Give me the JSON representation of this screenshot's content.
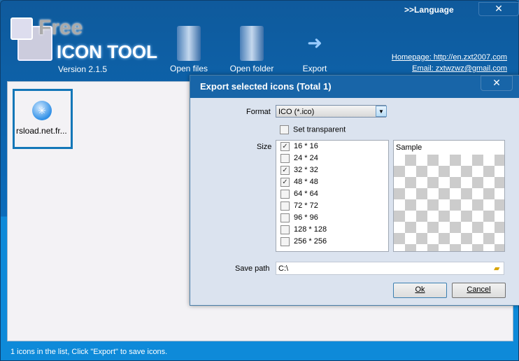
{
  "header": {
    "language": ">>Language",
    "close": "✕",
    "logo_free": "Free",
    "logo_main": "ICON TOOL",
    "version": "Version 2.1.5",
    "tools": [
      {
        "label": "Open files",
        "icon": "open-files-icon"
      },
      {
        "label": "Open folder",
        "icon": "open-folder-icon"
      },
      {
        "label": "Export",
        "icon": "export-arrow-icon"
      }
    ],
    "homepage": "Homepage: http://en.zxt2007.com",
    "email": "Email: zxtwzwz@gmail.com"
  },
  "list": {
    "items": [
      {
        "name": "rsload.net.fr..."
      }
    ]
  },
  "status": "1 icons in the list, Click \"Export\" to save icons.",
  "dialog": {
    "title": "Export selected icons (Total 1)",
    "close": "✕",
    "format_label": "Format",
    "format_value": "ICO (*.ico)",
    "transparent_label": "Set transparent",
    "transparent_checked": false,
    "size_label": "Size",
    "sizes": [
      {
        "label": "16 * 16",
        "checked": true
      },
      {
        "label": "24 * 24",
        "checked": false
      },
      {
        "label": "32 * 32",
        "checked": true
      },
      {
        "label": "48 * 48",
        "checked": true
      },
      {
        "label": "64 * 64",
        "checked": false
      },
      {
        "label": "72 * 72",
        "checked": false
      },
      {
        "label": "96 * 96",
        "checked": false
      },
      {
        "label": "128 * 128",
        "checked": false
      },
      {
        "label": "256 * 256",
        "checked": false
      }
    ],
    "sample_label": "Sample",
    "save_path_label": "Save path",
    "save_path": "C:\\",
    "ok": "Ok",
    "cancel": "Cancel"
  }
}
